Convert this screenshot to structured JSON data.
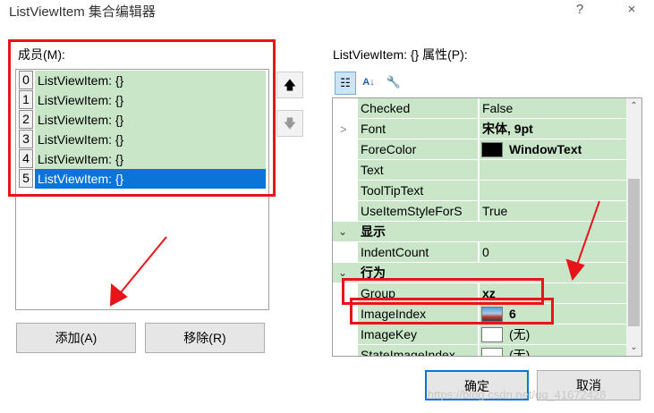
{
  "window": {
    "title": "ListViewItem 集合编辑器",
    "help_glyph": "?",
    "close_glyph": "×"
  },
  "members": {
    "label": "成员(M):",
    "items": [
      {
        "index": "0",
        "text": "ListViewItem: {}"
      },
      {
        "index": "1",
        "text": "ListViewItem: {}"
      },
      {
        "index": "2",
        "text": "ListViewItem: {}"
      },
      {
        "index": "3",
        "text": "ListViewItem: {}"
      },
      {
        "index": "4",
        "text": "ListViewItem: {}"
      },
      {
        "index": "5",
        "text": "ListViewItem: {}"
      }
    ],
    "selected_index": 5,
    "move_up_glyph": "🡅",
    "move_down_glyph": "🡇"
  },
  "buttons": {
    "add": "添加(A)",
    "remove": "移除(R)",
    "ok": "确定",
    "cancel": "取消"
  },
  "properties": {
    "label": "ListViewItem: {} 属性(P):",
    "toolbar": {
      "categorized_glyph": "☷",
      "alphabetical_glyph": "A↓",
      "pages_glyph": "🔧"
    },
    "rows": {
      "checked": {
        "name": "Checked",
        "value": "False"
      },
      "font": {
        "name": "Font",
        "value": "宋体, 9pt",
        "expander": ">"
      },
      "forecolor": {
        "name": "ForeColor",
        "value": "WindowText",
        "color": "#000000"
      },
      "text": {
        "name": "Text",
        "value": ""
      },
      "tooltip": {
        "name": "ToolTipText",
        "value": ""
      },
      "useitemstyle": {
        "name": "UseItemStyleForS",
        "value": "True"
      },
      "cat_display": {
        "name": "显示",
        "chevron": "⌄"
      },
      "indentcount": {
        "name": "IndentCount",
        "value": "0"
      },
      "cat_behavior": {
        "name": "行为",
        "chevron": "⌄"
      },
      "group": {
        "name": "Group",
        "value": "xz"
      },
      "imageindex": {
        "name": "ImageIndex",
        "value": "6"
      },
      "imagekey": {
        "name": "ImageKey",
        "value": "(无)"
      },
      "stateimageindex": {
        "name": "StateImageIndex",
        "value": "(无)"
      }
    },
    "scroll_up_glyph": "⌃",
    "scroll_down_glyph": "⌄"
  },
  "watermark": "https://blog.csdn.net/qq_41672428",
  "colors": {
    "accent": "#0a74d9",
    "row_bg": "#c9e6c9",
    "annotation_red": "#e8141a"
  }
}
